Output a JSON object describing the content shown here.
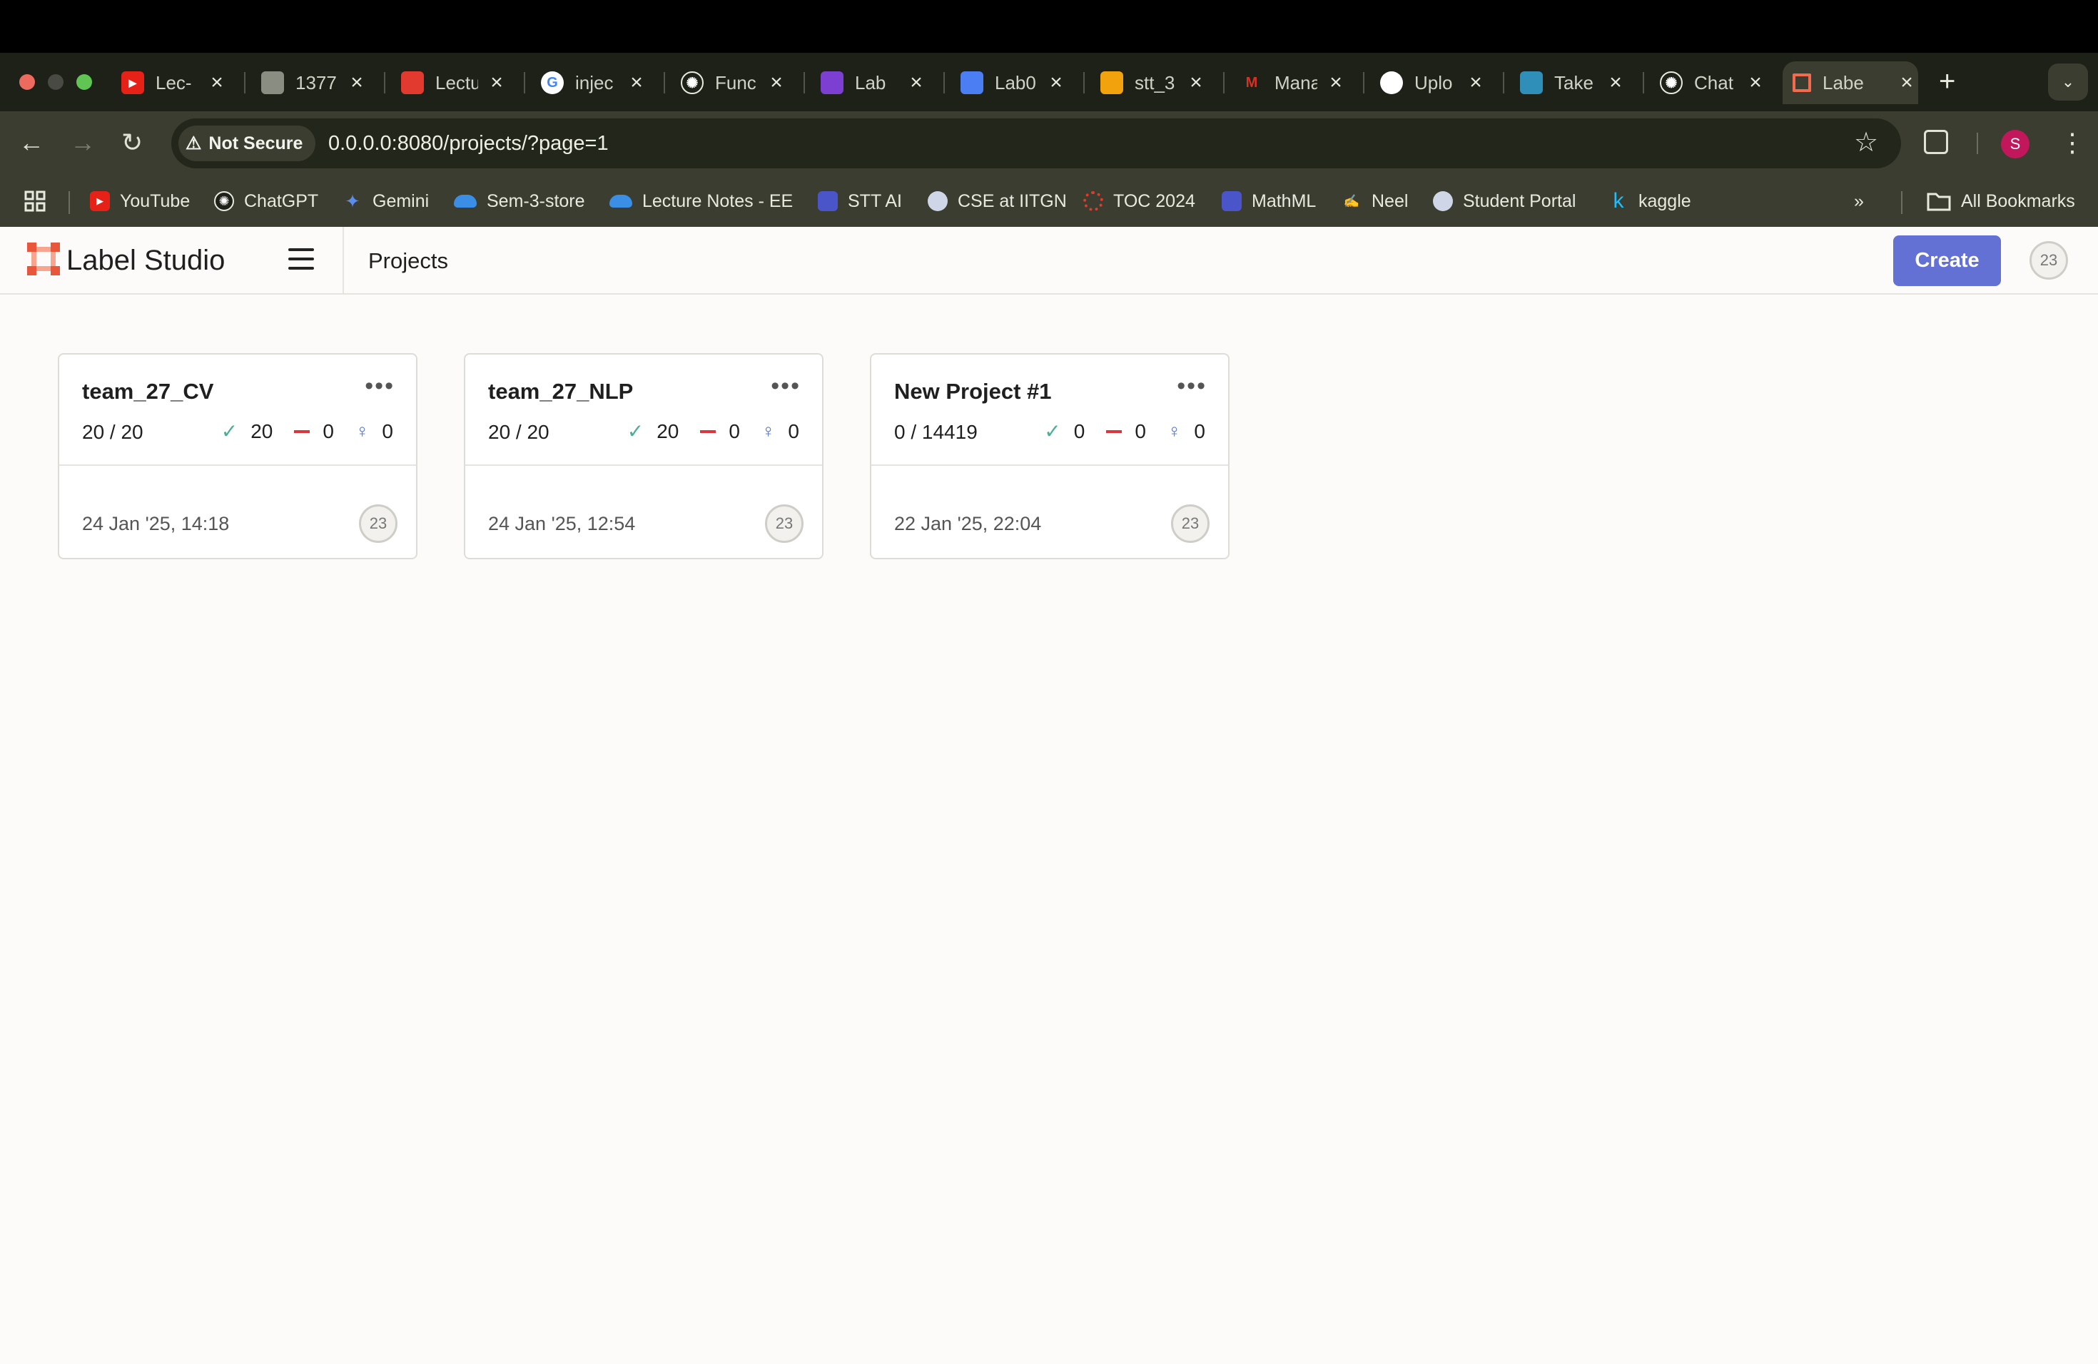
{
  "browser": {
    "tabs": [
      {
        "title": "Lec-",
        "icon": "youtube-icon",
        "color": "#e62117"
      },
      {
        "title": "1377",
        "icon": "globe-icon",
        "color": "#8a8e82"
      },
      {
        "title": "Lectu",
        "icon": "canvas-icon",
        "color": "#e23a2e"
      },
      {
        "title": "injec",
        "icon": "google-icon",
        "color": "#ffffff"
      },
      {
        "title": "Func",
        "icon": "openai-icon",
        "color": "#1e2117"
      },
      {
        "title": "Lab",
        "icon": "classroom-icon",
        "color": "#7c3fd1"
      },
      {
        "title": "Lab0",
        "icon": "docs-icon",
        "color": "#4c7ef3"
      },
      {
        "title": "stt_3",
        "icon": "colab-icon",
        "color": "#f2a20c"
      },
      {
        "title": "Mana",
        "icon": "gmail-icon",
        "color": "#ffffff"
      },
      {
        "title": "Uplo",
        "icon": "github-icon",
        "color": "#ffffff"
      },
      {
        "title": "Take",
        "icon": "meet-icon",
        "color": "#2f8fb8"
      },
      {
        "title": "Chat",
        "icon": "openai-icon",
        "color": "#1e2117"
      },
      {
        "title": "Labe",
        "icon": "label-studio-icon",
        "color": "#f26b4e"
      }
    ],
    "security_label": "Not Secure",
    "url": "0.0.0.0:8080/projects/?page=1",
    "profile_initial": "S",
    "bookmarks": [
      {
        "label": "YouTube",
        "icon": "youtube-icon",
        "color": "#e62117"
      },
      {
        "label": "ChatGPT",
        "icon": "openai-icon",
        "color": "#1e2117"
      },
      {
        "label": "Gemini",
        "icon": "gemini-icon",
        "color": "#5b8def"
      },
      {
        "label": "Sem-3-store",
        "icon": "onedrive-icon",
        "color": "#3a8ee6"
      },
      {
        "label": "Lecture Notes - EE",
        "icon": "onedrive-icon",
        "color": "#3a8ee6"
      },
      {
        "label": "STT AI",
        "icon": "calendar-icon",
        "color": "#4a55c9"
      },
      {
        "label": "CSE at IITGN",
        "icon": "iitgn-icon",
        "color": "#cfd6e8"
      },
      {
        "label": "TOC 2024",
        "icon": "canvas-icon",
        "color": "#e23a2e"
      },
      {
        "label": "MathML",
        "icon": "calendar-icon",
        "color": "#4a55c9"
      },
      {
        "label": "Neel",
        "icon": "sign-icon",
        "color": "#d9b94a"
      },
      {
        "label": "Student Portal",
        "icon": "iitgn-icon",
        "color": "#cfd6e8"
      },
      {
        "label": "kaggle",
        "icon": "kaggle-icon",
        "color": "#20beff"
      }
    ],
    "all_bookmarks_label": "All Bookmarks"
  },
  "app": {
    "brand": "Label Studio",
    "breadcrumb": "Projects",
    "create_label": "Create",
    "user_initials": "23",
    "accent": "#6371d4"
  },
  "projects": [
    {
      "name": "team_27_CV",
      "progress": "20 / 20",
      "completed": "20",
      "skipped": "0",
      "predictions": "0",
      "date": "24 Jan '25, 14:18",
      "owner": "23"
    },
    {
      "name": "team_27_NLP",
      "progress": "20 / 20",
      "completed": "20",
      "skipped": "0",
      "predictions": "0",
      "date": "24 Jan '25, 12:54",
      "owner": "23"
    },
    {
      "name": "New Project #1",
      "progress": "0 / 14419",
      "completed": "0",
      "skipped": "0",
      "predictions": "0",
      "date": "22 Jan '25, 22:04",
      "owner": "23"
    }
  ]
}
